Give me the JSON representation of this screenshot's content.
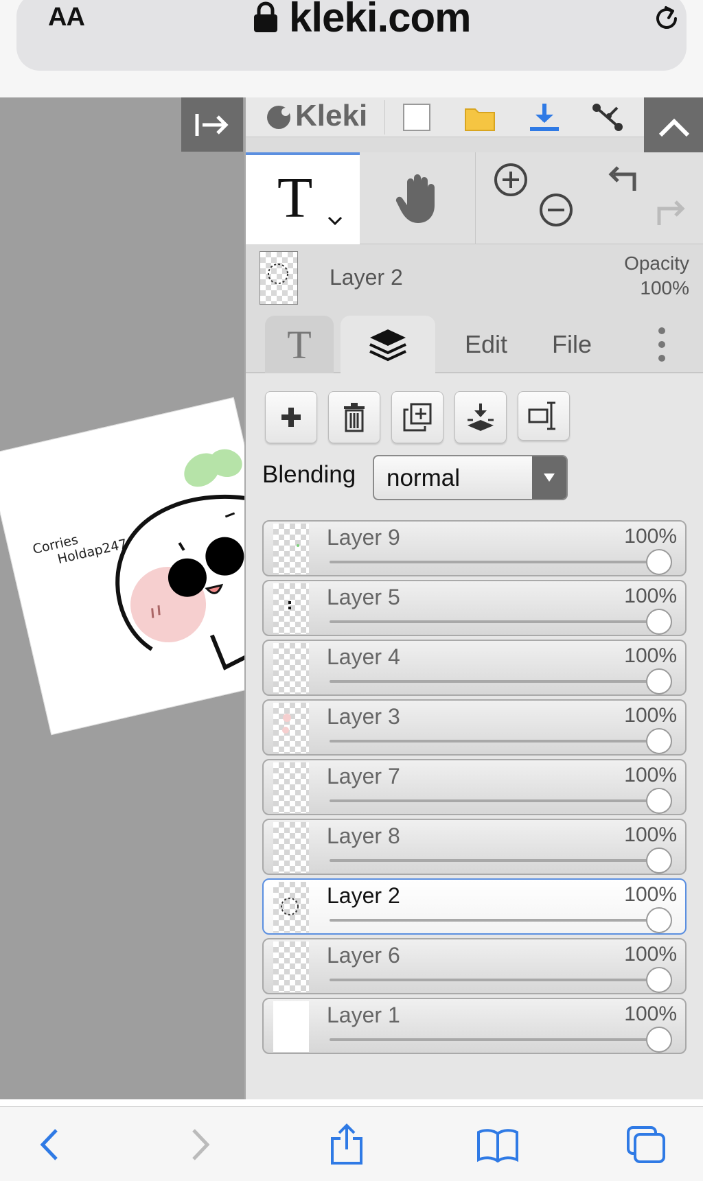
{
  "browser": {
    "text_size_label": "AA",
    "url": "kleki.com"
  },
  "app": {
    "logo_text": "Kleki"
  },
  "current_layer": {
    "name": "Layer 2",
    "opacity_label": "Opacity",
    "opacity_value": "100%"
  },
  "tabs": {
    "edit": "Edit",
    "file": "File"
  },
  "tool_icons": {
    "text_tool_glyph": "T",
    "text_tab_glyph": "T"
  },
  "blending": {
    "label": "Blending",
    "value": "normal"
  },
  "artwork": {
    "caption_line1": "Corries",
    "caption_line2": "Holdap247"
  },
  "layers": [
    {
      "name": "Layer 9",
      "opacity": "100%",
      "opacity_value": 1.0,
      "selected": false
    },
    {
      "name": "Layer 5",
      "opacity": "100%",
      "opacity_value": 1.0,
      "selected": false
    },
    {
      "name": "Layer 4",
      "opacity": "100%",
      "opacity_value": 1.0,
      "selected": false
    },
    {
      "name": "Layer 3",
      "opacity": "100%",
      "opacity_value": 1.0,
      "selected": false
    },
    {
      "name": "Layer 7",
      "opacity": "100%",
      "opacity_value": 1.0,
      "selected": false
    },
    {
      "name": "Layer 8",
      "opacity": "100%",
      "opacity_value": 1.0,
      "selected": false
    },
    {
      "name": "Layer 2",
      "opacity": "100%",
      "opacity_value": 1.0,
      "selected": true
    },
    {
      "name": "Layer 6",
      "opacity": "100%",
      "opacity_value": 1.0,
      "selected": false
    },
    {
      "name": "Layer 1",
      "opacity": "100%",
      "opacity_value": 1.0,
      "selected": false
    }
  ],
  "colors": {
    "accent_blue": "#5b8fe0",
    "download_blue": "#2f7ae5",
    "folder_yellow": "#f5c542",
    "safari_blue": "#2f7ae5"
  }
}
